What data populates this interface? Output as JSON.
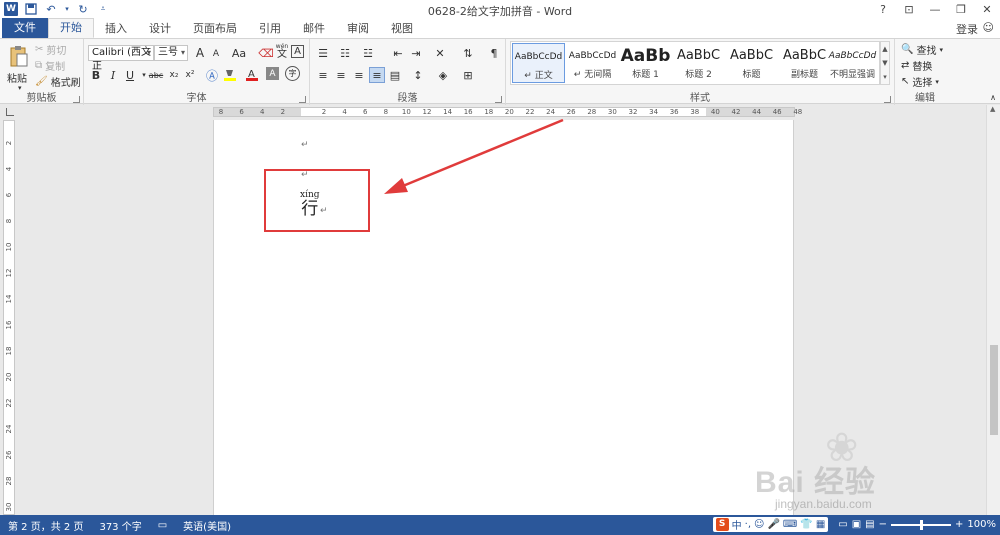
{
  "window": {
    "title": "0628-2给文字加拼音 - Word",
    "login": "登录"
  },
  "qat": {
    "app_icon_letter": "W",
    "items": [
      "save-icon",
      "undo-icon",
      "redo-icon",
      "customize-icon"
    ]
  },
  "tabs": [
    {
      "label": "文件",
      "kind": "file"
    },
    {
      "label": "开始",
      "kind": "active"
    },
    {
      "label": "插入"
    },
    {
      "label": "设计"
    },
    {
      "label": "页面布局"
    },
    {
      "label": "引用"
    },
    {
      "label": "邮件"
    },
    {
      "label": "审阅"
    },
    {
      "label": "视图"
    }
  ],
  "ribbon": {
    "clipboard": {
      "label": "剪贴板",
      "paste": "粘贴",
      "cut": "剪切",
      "copy": "复制",
      "format_painter": "格式刷"
    },
    "font": {
      "label": "字体",
      "font_name": "Calibri (西文正",
      "font_size": "三号",
      "bold": "B",
      "italic": "I",
      "underline": "U",
      "strikethrough": "abc",
      "subscript": "x₂",
      "superscript": "x²",
      "grow": "A",
      "shrink": "A",
      "case": "Aa",
      "phonetic_top": "wén",
      "phonetic_bottom": "文",
      "border_char": "A",
      "font_color_letter": "A",
      "shade_letter": "A",
      "circle_char": "字"
    },
    "paragraph": {
      "label": "段落"
    },
    "styles": {
      "label": "样式",
      "items": [
        {
          "sample": "AaBbCcDd",
          "name": "↵ 正文",
          "selected": true
        },
        {
          "sample": "AaBbCcDd",
          "name": "↵ 无间隔"
        },
        {
          "sample": "AaBb",
          "name": "标题 1"
        },
        {
          "sample": "AaBbC",
          "name": "标题 2"
        },
        {
          "sample": "AaBbC",
          "name": "标题"
        },
        {
          "sample": "AaBbC",
          "name": "副标题"
        },
        {
          "sample": "AaBbCcDd",
          "name": "不明显强调"
        }
      ]
    },
    "editing": {
      "label": "编辑",
      "find": "查找",
      "replace": "替换",
      "select": "选择"
    }
  },
  "ruler": {
    "ticks": [
      "8",
      "6",
      "4",
      "2",
      "",
      "2",
      "4",
      "6",
      "8",
      "10",
      "12",
      "14",
      "16",
      "18",
      "20",
      "22",
      "24",
      "26",
      "28",
      "30",
      "32",
      "34",
      "36",
      "38",
      "40",
      "42",
      "44",
      "46",
      "48"
    ]
  },
  "vruler": {
    "ticks": [
      "2",
      "4",
      "6",
      "8",
      "10",
      "12",
      "14",
      "16",
      "18",
      "20",
      "22",
      "24",
      "26",
      "28",
      "30"
    ]
  },
  "document": {
    "para_mark": "↵",
    "pinyin": "xíng",
    "hanzi": "行"
  },
  "watermark": {
    "text": "Bai 经验",
    "sub": "jingyan.baidu.com"
  },
  "status": {
    "page": "第 2 页，共 2 页",
    "words": "373 个字",
    "language": "英语(美国)",
    "ime_logo": "S",
    "ime_mode": "中",
    "zoom": "100%"
  },
  "colors": {
    "accent": "#2b579a",
    "highlight_box": "#e03b3b",
    "font_color_bar": "#e02020",
    "highlight_bar": "#ffff00"
  }
}
